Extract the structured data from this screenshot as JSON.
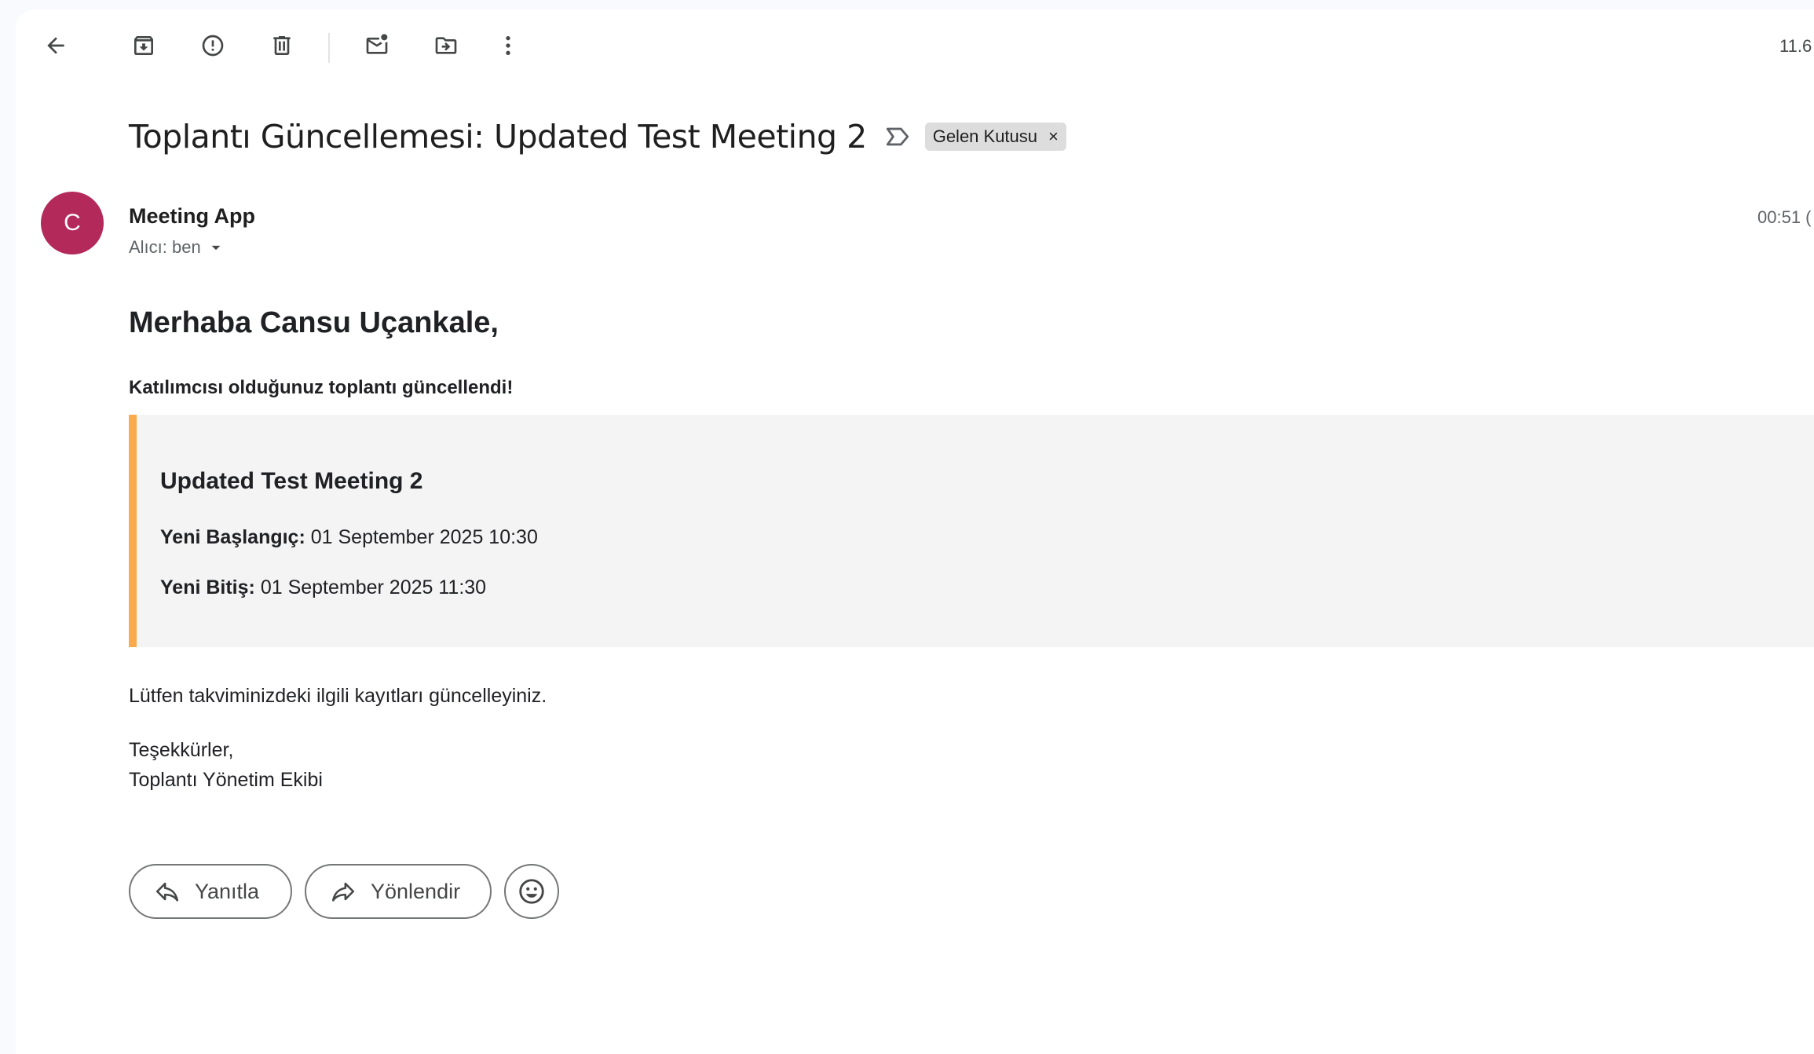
{
  "toolbar": {
    "icons": [
      "back-arrow-icon",
      "archive-icon",
      "report-spam-icon",
      "delete-icon",
      "mark-unread-icon",
      "move-to-icon",
      "more-options-icon"
    ],
    "page_count": "11.6"
  },
  "email": {
    "subject": "Toplantı Güncellemesi: Updated Test Meeting 2",
    "label_chip": "Gelen Kutusu",
    "label_close": "×",
    "sender": {
      "initial": "C",
      "name": "Meeting App",
      "recipient": "Alıcı: ben",
      "time": "00:51 ("
    },
    "body": {
      "greeting": "Merhaba Cansu Uçankale,",
      "intro": "Katılımcısı olduğunuz toplantı güncellendi!",
      "meeting": {
        "title": "Updated Test Meeting 2",
        "start_label": "Yeni Başlangıç:",
        "start_value": " 01 September 2025 10:30",
        "end_label": "Yeni Bitiş:",
        "end_value": " 01 September 2025 11:30"
      },
      "note": "Lütfen takviminizdeki ilgili kayıtları güncelleyiniz.",
      "thanks": "Teşekkürler,",
      "team": "Toplantı Yönetim Ekibi"
    }
  },
  "actions": {
    "reply_label": "Yanıtla",
    "forward_label": "Yönlendir"
  },
  "colors": {
    "avatar": "#b3295a",
    "accent_border": "#fbab4b",
    "meeting_box_bg": "#f4f4f4",
    "label_chip_bg": "#dddddd"
  }
}
